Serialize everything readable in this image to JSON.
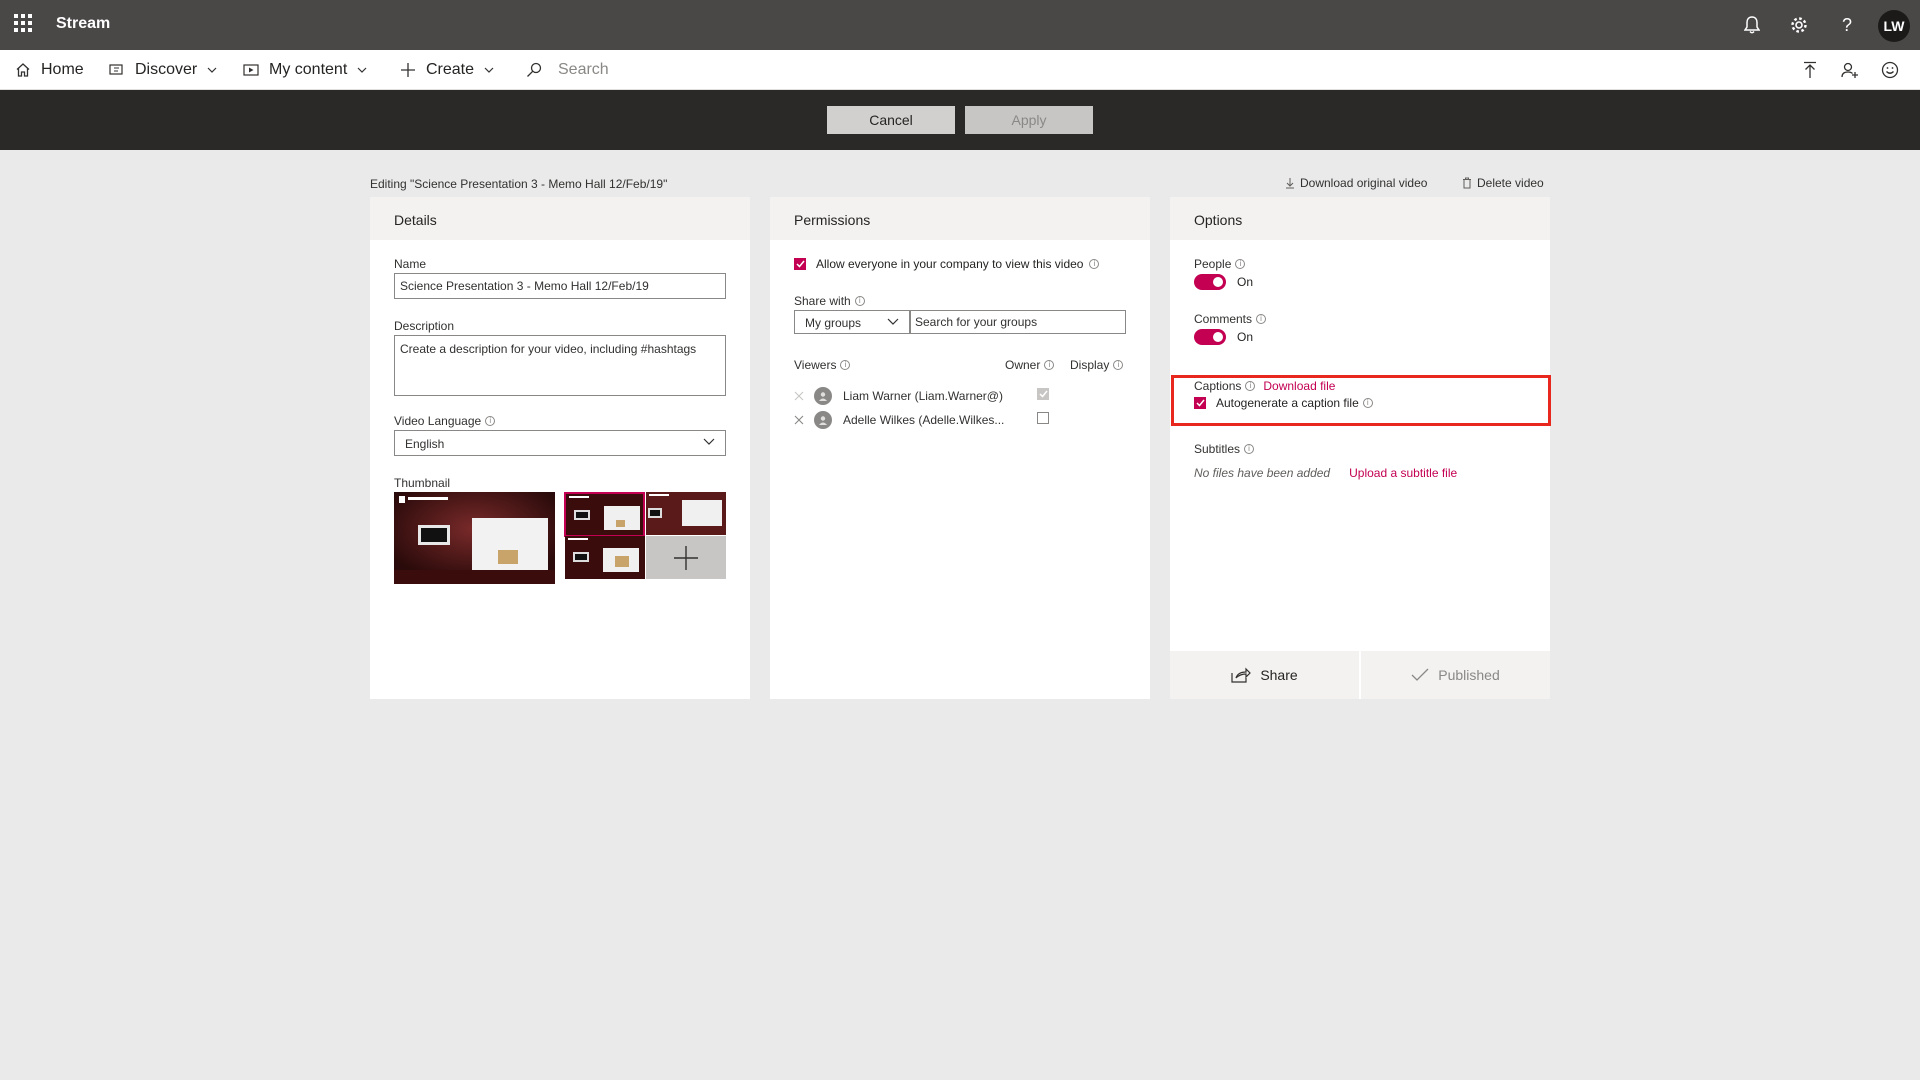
{
  "app": {
    "name": "Stream",
    "user_initials": "LW"
  },
  "appbar_icons": [
    "bell-icon",
    "gear-icon",
    "help-icon"
  ],
  "nav": {
    "home": "Home",
    "discover": "Discover",
    "my_content": "My content",
    "create": "Create",
    "search_placeholder": "Search",
    "right_icons": [
      "upload-icon",
      "person-add-icon",
      "smiley-icon"
    ]
  },
  "actions": {
    "cancel": "Cancel",
    "apply": "Apply"
  },
  "page": {
    "editing_title": "Editing \"Science Presentation 3 - Memo Hall 12/Feb/19\"",
    "download_original": "Download original video",
    "delete_video": "Delete video"
  },
  "details": {
    "header": "Details",
    "name_label": "Name",
    "name_value": "Science Presentation 3 - Memo Hall 12/Feb/19",
    "description_label": "Description",
    "description_placeholder": "Create a description for your video, including #hashtags",
    "language_label": "Video Language",
    "language_value": "English",
    "thumbnail_label": "Thumbnail"
  },
  "permissions": {
    "header": "Permissions",
    "allow_everyone": "Allow everyone in your company to view this video",
    "allow_everyone_checked": true,
    "share_with_label": "Share with",
    "share_with_value": "My groups",
    "search_groups_placeholder": "Search for your groups",
    "viewers_label": "Viewers",
    "owner_label": "Owner",
    "display_label": "Display",
    "viewers": [
      {
        "name": "Liam Warner (Liam.Warner@)",
        "owner": true
      },
      {
        "name": "Adelle Wilkes (Adelle.Wilkes...",
        "owner": false
      }
    ]
  },
  "options": {
    "header": "Options",
    "people_label": "People",
    "people_state": "On",
    "comments_label": "Comments",
    "comments_state": "On",
    "captions_label": "Captions",
    "download_file": "Download file",
    "autogenerate_label": "Autogenerate a caption file",
    "autogenerate_checked": true,
    "subtitles_label": "Subtitles",
    "no_files": "No files have been added",
    "upload_subtitle": "Upload a subtitle file",
    "share": "Share",
    "published": "Published"
  },
  "colors": {
    "accent": "#c30052",
    "appbar": "#4a4747",
    "actionbar": "#2b2828",
    "highlight": "#e8281f"
  }
}
